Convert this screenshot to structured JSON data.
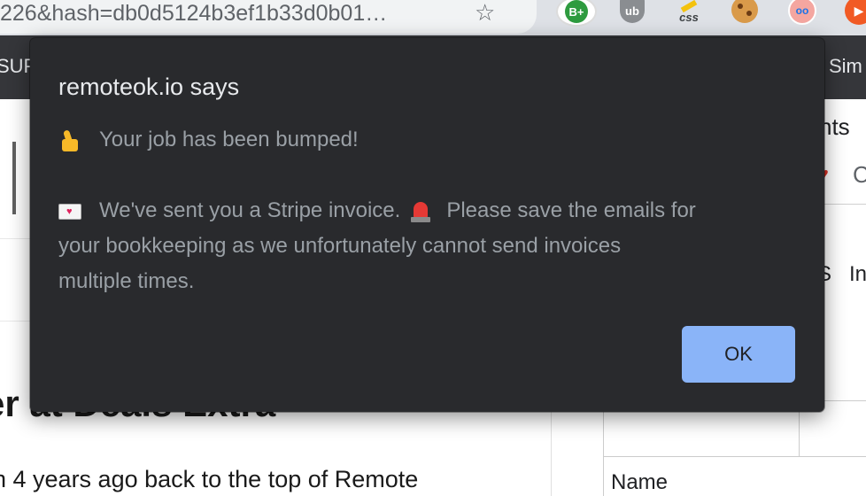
{
  "browser": {
    "url_fragment": "226&hash=db0d5124b3ef1b33d0b01…",
    "extensions": [
      {
        "name": "bplus-extension-icon",
        "label": "B+"
      },
      {
        "name": "ublock-icon",
        "label": "ub"
      },
      {
        "name": "css-extension-icon",
        "label": "css"
      },
      {
        "name": "cookie-icon",
        "label": ""
      },
      {
        "name": "avatar-extension-icon",
        "label": ""
      },
      {
        "name": "orange-extension-icon",
        "label": ""
      }
    ],
    "bookmarks_left": "SUP",
    "bookmarks_right": "Sim"
  },
  "page": {
    "heading_partial": "er at Deals Extra",
    "body_partial": "n 4 years ago back to the top of Remote",
    "right_text_1": "nts",
    "right_C": "C",
    "right_S": "S",
    "right_In": "In",
    "table_header": "Name"
  },
  "dialog": {
    "title": "remoteok.io says",
    "line1": "Your job has been bumped!",
    "line2_a": "We've sent you a Stripe invoice.",
    "line2_b": "Please save the emails for",
    "line3": "your bookkeeping as we unfortunately cannot send invoices",
    "line4": "multiple times.",
    "ok_label": "OK",
    "accent_color": "#8ab4f8",
    "background_color": "#292a2d"
  }
}
